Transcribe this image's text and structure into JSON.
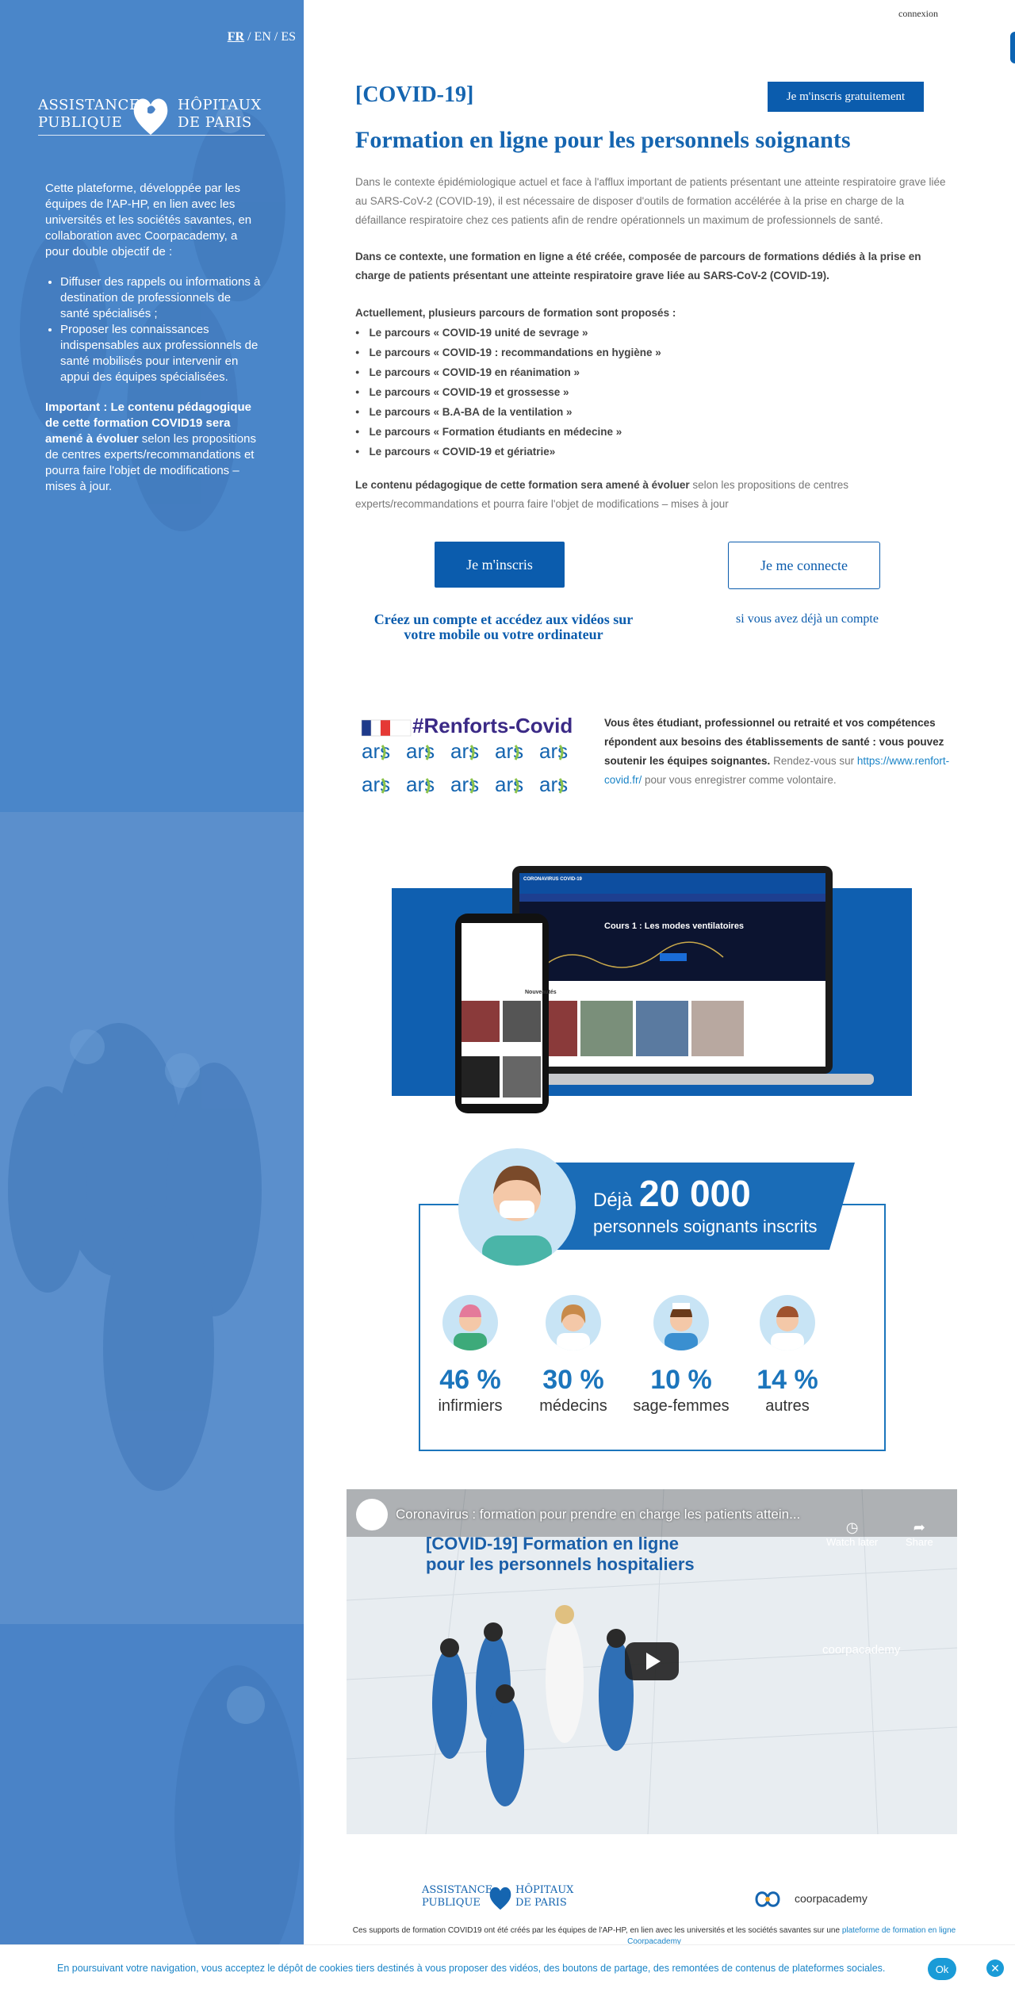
{
  "left": {
    "languages": [
      "FR",
      "EN",
      "ES"
    ],
    "logo": {
      "l1": "ASSISTANCE",
      "l2": "PUBLIQUE",
      "r1": "HÔPITAUX",
      "r2": "DE PARIS"
    },
    "intro": "Cette plateforme, développée par les équipes de l'AP-HP, en lien avec les universités et les sociétés savantes, en collaboration avec Coorpacademy, a pour double objectif de :",
    "bullets": [
      "Diffuser des rappels ou informations à destination de professionnels de santé spécialisés ;",
      "Proposer les connaissances indispensables aux professionnels de santé mobilisés pour intervenir en appui des équipes spécialisées."
    ],
    "important_bold": "Important : Le contenu pédagogique de cette formation COVID19 sera amené à évoluer",
    "important_rest": " selon les propositions de centres experts/recommandations et pourra faire l'objet de modifications – mises à jour."
  },
  "header": {
    "connexion": "connexion",
    "covid_title": "[COVID-19]",
    "free_button": "Je m'inscris gratuitement",
    "main_title": "Formation en ligne pour les personnels soignants"
  },
  "body": {
    "p1": "Dans le contexte épidémiologique actuel et face à l'afflux important de patients présentant une atteinte respiratoire grave liée au SARS-CoV-2 (COVID-19), il est nécessaire de disposer d'outils de formation accélérée à la prise en charge de la défaillance respiratoire chez ces patients afin de rendre opérationnels un maximum de professionnels de santé.",
    "p2": "Dans ce contexte, une formation en ligne a été créée, composée de parcours de formations dédiés à la prise en charge de patients présentant une atteinte respiratoire grave liée au SARS-CoV-2 (COVID-19).",
    "p3_intro": "Actuellement, plusieurs parcours de formation sont proposés :",
    "courses": [
      "Le parcours « COVID-19 unité de sevrage »",
      "Le parcours « COVID-19 : recommandations en hygiène »",
      "Le parcours « COVID-19 en réanimation »",
      "Le parcours « COVID-19 et grossesse »",
      "Le parcours « B.A-BA de la ventilation »",
      "Le parcours « Formation étudiants en médecine »",
      "Le parcours « COVID-19 et gériatrie»"
    ],
    "p4_bold": "Le contenu pédagogique de cette formation sera amené à évoluer",
    "p4_rest": " selon les propositions de centres experts/recommandations et pourra faire l'objet de modifications – mises à jour"
  },
  "cta": {
    "inscris": "Je m'inscris",
    "connecte": "Je me connecte",
    "inscris_caption": "Créez un compte et accédez aux vidéos sur votre mobile ou votre ordinateur",
    "connecte_caption": "si vous avez déjà un compte"
  },
  "renforts": {
    "logo_text": "#Renforts-Covid",
    "ars": "ars",
    "bold": "Vous êtes étudiant, professionnel ou retraité et vos compétences répondent aux besoins des établissements de santé : vous pouvez soutenir les équipes soignantes.",
    "rest": " Rendez-vous sur ",
    "link": "https://www.renfort-covid.fr/",
    "end": " pour vous enregistrer comme volontaire."
  },
  "devices": {
    "brand": "CORONAVIRUS COVID-19",
    "course": "Cours 1 : Les modes ventilatoires",
    "section": "Nouveautés"
  },
  "stats": {
    "deja": "Déjà",
    "big": "20 000",
    "sub": "personnels soignants inscrits",
    "items": [
      {
        "pct": "46 %",
        "label": "infirmiers"
      },
      {
        "pct": "30 %",
        "label": "médecins"
      },
      {
        "pct": "10 %",
        "label": "sage-femmes"
      },
      {
        "pct": "14 %",
        "label": "autres"
      }
    ]
  },
  "video": {
    "title": "Coronavirus : formation pour prendre en charge les patients attein...",
    "behind1": "[COVID-19] Formation en ligne",
    "behind2": "pour les personnels hospitaliers",
    "watch_later": "Watch later",
    "share": "Share",
    "coorp": "coorpacademy"
  },
  "footer": {
    "text": "Ces supports de formation COVID19 ont été créés par les équipes de l'AP-HP, en lien avec les universités et les sociétés savantes sur une ",
    "link": "plateforme de formation en ligne Coorpacademy"
  },
  "cookie": {
    "message": "En poursuivant votre navigation, vous acceptez le dépôt de cookies tiers destinés à vous proposer des vidéos, des boutons de partage, des remontées de contenus de plateformes sociales.",
    "ok": "Ok"
  },
  "colors": {
    "primary": "#0b5cad",
    "left_panel": "#4a83c7",
    "link": "#1a84c7"
  }
}
